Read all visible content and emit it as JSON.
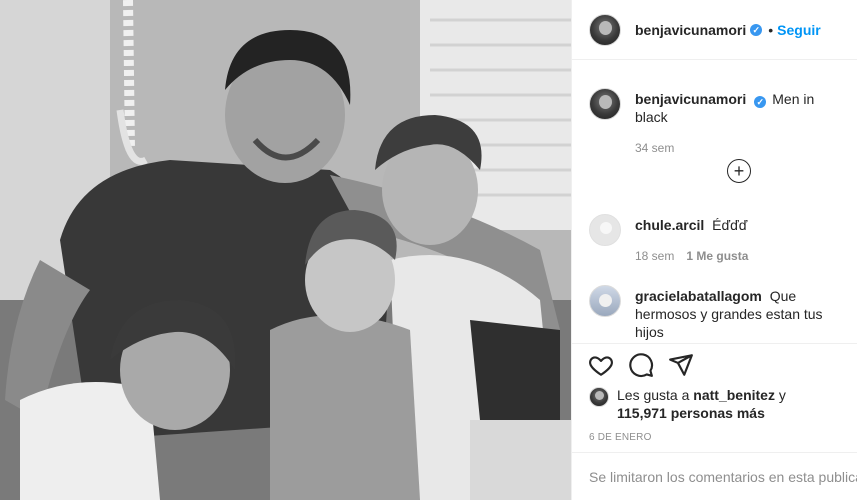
{
  "post": {
    "author": "benjavicunamori",
    "follow_label": "Seguir",
    "separator": "•",
    "verified_mark": "✓",
    "caption_text": "Men in black",
    "caption_time": "34 sem",
    "load_more_symbol": "+",
    "comments": [
      {
        "user": "chule.arcil",
        "text": "Éďďď",
        "time": "18 sem",
        "likes": "1 Me gusta"
      },
      {
        "user": "gracielabatallagom",
        "text": "Que hermosos y grandes estan tus hijos"
      }
    ],
    "likes": {
      "prefix": "Les gusta a",
      "user": "natt_benitez",
      "connector": "y",
      "count": "115,971 personas más"
    },
    "date": "6 DE ENERO",
    "comments_closed": "Se limitaron los comentarios en esta publicación"
  },
  "icons": {
    "like": "heart-icon",
    "comment": "comment-icon",
    "share": "share-icon",
    "add": "plus-circle-icon"
  },
  "colors": {
    "accent": "#0095f6",
    "verified": "#3897f0",
    "muted": "#8e8e8e"
  }
}
